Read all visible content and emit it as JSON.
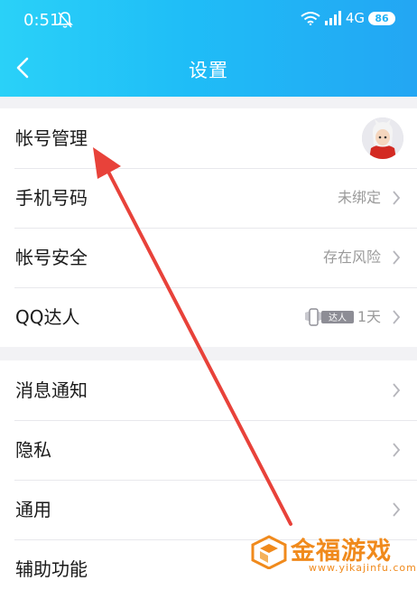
{
  "status_bar": {
    "time": "0:51",
    "network": "4G",
    "battery": "86"
  },
  "header": {
    "title": "设置"
  },
  "account_group": [
    {
      "label": "帐号管理",
      "value": ""
    },
    {
      "label": "手机号码",
      "value": "未绑定"
    },
    {
      "label": "帐号安全",
      "value": "存在风险"
    },
    {
      "label": "QQ达人",
      "value": "1天",
      "badge": "达人"
    }
  ],
  "general_group": [
    {
      "label": "消息通知"
    },
    {
      "label": "隐私"
    },
    {
      "label": "通用"
    },
    {
      "label": "辅助功能"
    }
  ],
  "watermark": {
    "name": "金福游戏",
    "url": "www.yikajinfu.com"
  },
  "colors": {
    "header_start": "#2ad1f8",
    "header_end": "#23a6f3",
    "arrow": "#e8423a",
    "watermark": "#f08a1c"
  },
  "icons": [
    "bell-muted-icon",
    "wifi-icon",
    "signal-icon",
    "back-chevron-icon",
    "chevron-right-icon",
    "qq-talent-badge-icon",
    "avatar-image"
  ]
}
